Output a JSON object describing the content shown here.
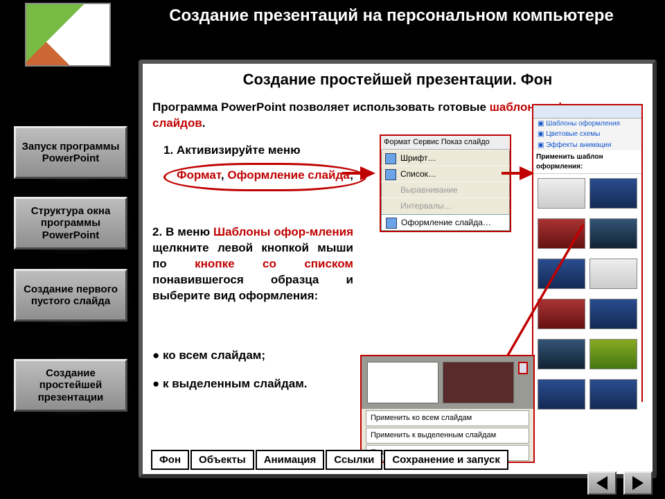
{
  "header": "Создание презентаций на персональном компьютере",
  "content": {
    "title": "Создание простейшей презентации. Фон",
    "intro_plain": "Программа PowerPoint позволяет использовать готовые ",
    "intro_red": "шаблоны оформления слайдов",
    "intro_tail": ".",
    "step1_num": "1.",
    "step1_label": "Активизируйте меню",
    "step1_red1": "Формат",
    "step1_comma": ", ",
    "step1_red2": "Оформление слайда",
    "step1_semi": ";",
    "step2_a": "2. В меню ",
    "step2_red1": "Шаблоны офор-мления",
    "step2_b": " щелкните левой кнопкой мыши по ",
    "step2_red2": "кнопке со списком",
    "step2_c": " понавившегося образца и выберите вид оформления:",
    "bullet1": "● ко всем слайдам;",
    "bullet2": "● к выделенным слайдам."
  },
  "format_menu": {
    "tabs": "Формат   Сервис   Показ слайдо",
    "items": [
      "Шрифт…",
      "Список…",
      "Выравнивание",
      "Интервалы…",
      "Оформление слайда…"
    ]
  },
  "templates": {
    "line1": "Шаблоны оформления",
    "line2": "Цветовые схемы",
    "line3": "Эффекты анимации",
    "caption": "Применить шаблон оформления:"
  },
  "popup": {
    "items": [
      "Применить ко всем слайдам",
      "Применить к выделенным слайдам",
      "Показать крупные эскизы"
    ]
  },
  "sidebar": [
    "Запуск программы PowerPoint",
    "Структура окна программы PowerPoint",
    "Создание первого пустого слайда",
    "Создание простейшей презентации"
  ],
  "tabs": [
    "Фон",
    "Объекты",
    "Анимация",
    "Ссылки",
    "Сохранение и запуск"
  ]
}
